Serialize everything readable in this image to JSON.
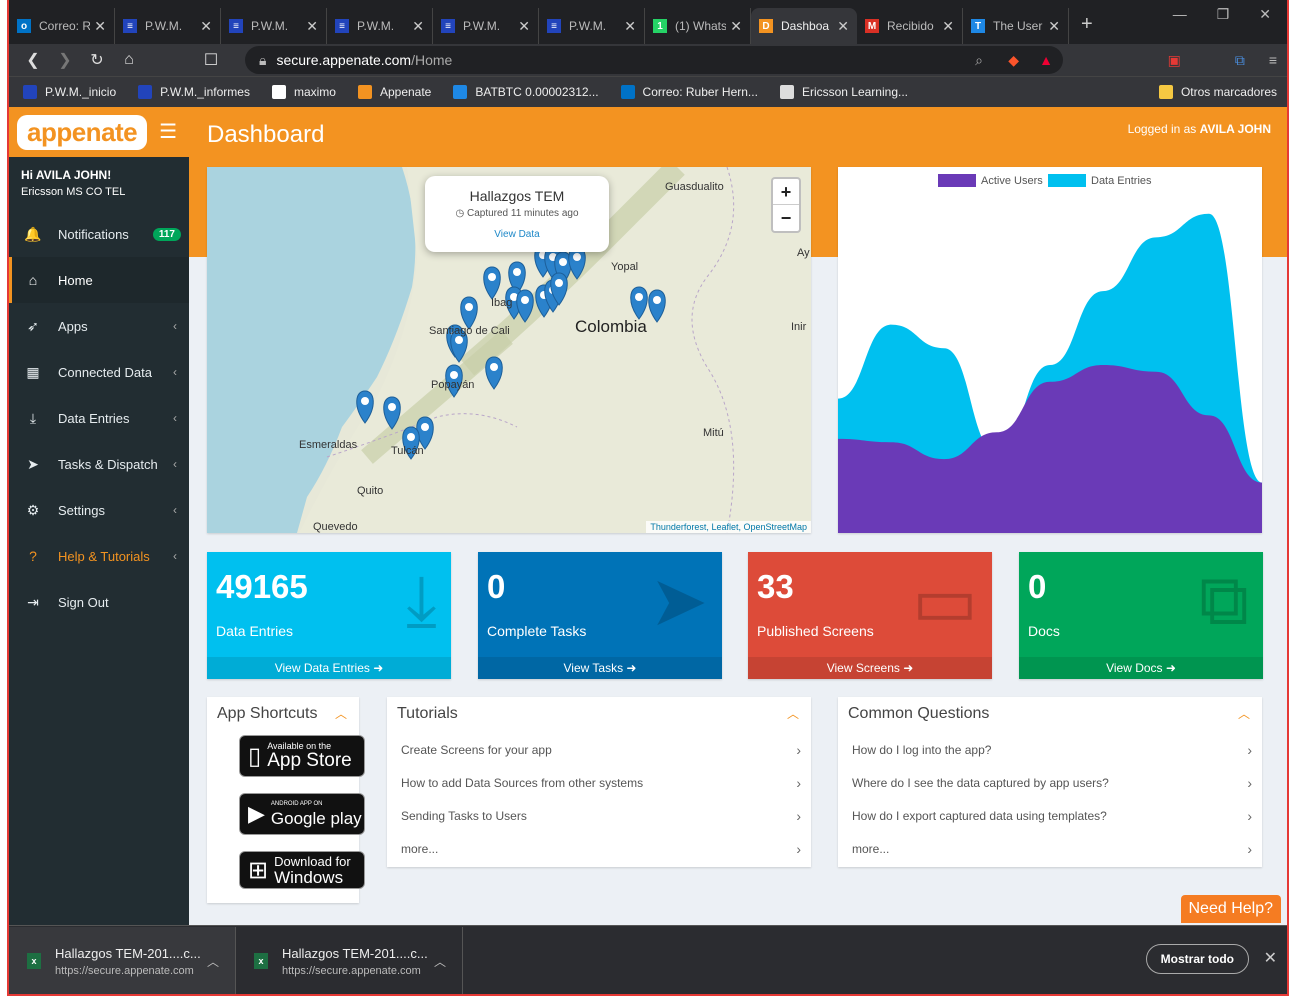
{
  "browser": {
    "tabs": [
      {
        "title": "Correo: R",
        "color": "#0072c6",
        "glyph": "o"
      },
      {
        "title": "P.W.M.",
        "color": "#2244bb",
        "glyph": "≡"
      },
      {
        "title": "P.W.M.",
        "color": "#2244bb",
        "glyph": "≡"
      },
      {
        "title": "P.W.M.",
        "color": "#2244bb",
        "glyph": "≡"
      },
      {
        "title": "P.W.M.",
        "color": "#2244bb",
        "glyph": "≡"
      },
      {
        "title": "P.W.M.",
        "color": "#2244bb",
        "glyph": "≡"
      },
      {
        "title": "(1) Whats",
        "color": "#25d366",
        "glyph": "1"
      },
      {
        "title": "Dashboa",
        "color": "#f39321",
        "glyph": "D"
      },
      {
        "title": "Recibido",
        "color": "#d93025",
        "glyph": "M"
      },
      {
        "title": "The User",
        "color": "#1e88e5",
        "glyph": "T"
      }
    ],
    "url_host": "secure.appenate.com",
    "url_path": "/Home",
    "bookmarks": [
      {
        "label": "P.W.M._inicio",
        "color": "#2244bb"
      },
      {
        "label": "P.W.M._informes",
        "color": "#2244bb"
      },
      {
        "label": "maximo",
        "color": "#ffffff"
      },
      {
        "label": "Appenate",
        "color": "#f39321"
      },
      {
        "label": "BATBTC 0.00002312...",
        "color": "#1e88e5"
      },
      {
        "label": "Correo: Ruber Hern...",
        "color": "#0072c6"
      },
      {
        "label": "Ericsson Learning...",
        "color": "#dddddd"
      }
    ],
    "other_bookmarks": "Otros marcadores"
  },
  "app": {
    "logo": "appenate",
    "greeting": "Hi AVILA JOHN!",
    "org": "Ericsson MS CO TEL",
    "page_title": "Dashboard",
    "logged_prefix": "Logged in as",
    "logged_user": "AVILA JOHN",
    "menu": [
      {
        "label": "Notifications",
        "icon": "bell-icon",
        "glyph": "🔔",
        "badge": "117"
      },
      {
        "label": "Home",
        "icon": "home-icon",
        "glyph": "⌂",
        "active": true
      },
      {
        "label": "Apps",
        "icon": "rocket-icon",
        "glyph": "➶",
        "chev": true
      },
      {
        "label": "Connected Data",
        "icon": "table-icon",
        "glyph": "▦",
        "chev": true
      },
      {
        "label": "Data Entries",
        "icon": "download-icon",
        "glyph": "⤓",
        "chev": true
      },
      {
        "label": "Tasks & Dispatch",
        "icon": "paper-plane-icon",
        "glyph": "➤",
        "chev": true
      },
      {
        "label": "Settings",
        "icon": "gears-icon",
        "glyph": "⚙",
        "chev": true
      },
      {
        "label": "Help & Tutorials",
        "icon": "help-icon",
        "glyph": "?",
        "chev": true,
        "help": true
      },
      {
        "label": "Sign Out",
        "icon": "sign-out-icon",
        "glyph": "⇥"
      }
    ]
  },
  "map": {
    "popup_title": "Hallazgos TEM",
    "popup_sub": "Captured 11 minutes ago",
    "popup_link": "View Data",
    "zoom_in": "+",
    "zoom_out": "−",
    "country_label": "Colombia",
    "places": [
      "Guasdualito",
      "Yopal",
      "Esmeraldas",
      "Quito",
      "Quevedo",
      "Mitú",
      "Inir",
      "Ay",
      "Ibag",
      "Santiago de Cali",
      "Popayán",
      "Tulcán"
    ],
    "attribution": "Thunderforest, Leaflet, OpenStreetMap"
  },
  "chart_data": {
    "type": "area",
    "legend": [
      "Active Users",
      "Data Entries"
    ],
    "colors": [
      "#6a3ab7",
      "#00c0ef"
    ],
    "series": [
      {
        "name": "Active Users",
        "values": [
          28,
          27,
          22,
          30,
          45,
          50,
          48,
          35,
          15
        ]
      },
      {
        "name": "Data Entries",
        "values": [
          40,
          62,
          55,
          24,
          50,
          72,
          88,
          95,
          15
        ]
      }
    ]
  },
  "stats": [
    {
      "value": "49165",
      "label": "Data Entries",
      "link": "View Data Entries ➜",
      "color": "#00c0ef",
      "icon": "⤓"
    },
    {
      "value": "0",
      "label": "Complete Tasks",
      "link": "View Tasks ➜",
      "color": "#0073b7",
      "icon": "➤"
    },
    {
      "value": "33",
      "label": "Published Screens",
      "link": "View Screens ➜",
      "color": "#dd4b39",
      "icon": "▭"
    },
    {
      "value": "0",
      "label": "Docs",
      "link": "View Docs ➜",
      "color": "#00a65a",
      "icon": "⧉"
    }
  ],
  "shortcuts": {
    "title": "App Shortcuts",
    "appstore_small": "Available on the",
    "appstore_big": "App Store",
    "gplay_small": "ANDROID APP ON",
    "gplay_big": "Google play",
    "win_small": "Download for",
    "win_big": "Windows"
  },
  "tutorials": {
    "title": "Tutorials",
    "items": [
      "Create Screens for your app",
      "How to add Data Sources from other systems",
      "Sending Tasks to Users",
      "more..."
    ]
  },
  "questions": {
    "title": "Common Questions",
    "items": [
      "How do I log into the app?",
      "Where do I see the data captured by app users?",
      "How do I export captured data using templates?",
      "more..."
    ]
  },
  "need_help": "Need Help?",
  "downloads": [
    {
      "name": "Hallazgos TEM-201....c...",
      "url": "https://secure.appenate.com"
    },
    {
      "name": "Hallazgos TEM-201....c...",
      "url": "https://secure.appenate.com"
    }
  ],
  "show_all": "Mostrar todo"
}
